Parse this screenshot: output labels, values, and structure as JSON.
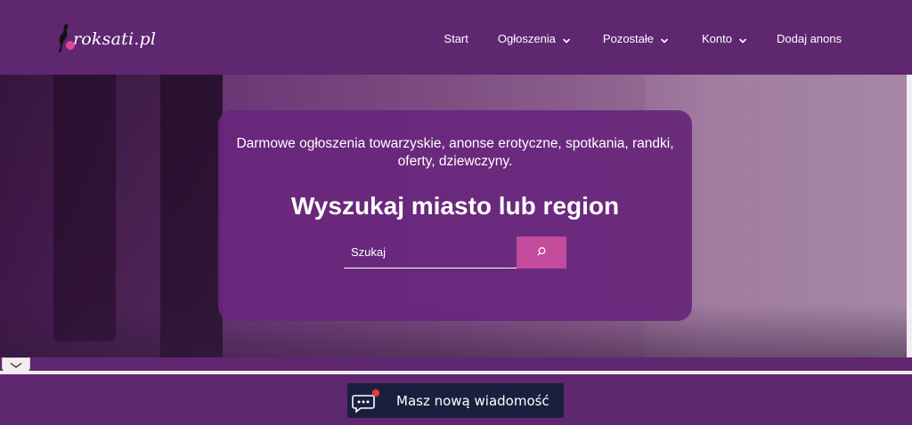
{
  "header": {
    "logo_text": "roksati.pl",
    "nav": {
      "start": "Start",
      "ogloszenia": "Ogłoszenia",
      "pozostale": "Pozostałe",
      "konto": "Konto",
      "dodaj": "Dodaj anons"
    }
  },
  "hero": {
    "description": "Darmowe ogłoszenia towarzyskie, anonse erotyczne, spotkania, randki, oferty, dziewczyny.",
    "title": "Wyszukaj miasto lub region",
    "search": {
      "placeholder": "Szukaj",
      "value": ""
    }
  },
  "notification": {
    "text": "Masz nową wiadomość"
  },
  "colors": {
    "brand_purple": "#5e2770",
    "card_purple": "#68267c",
    "accent_pink": "#c44a9c",
    "notification_bg": "#1b1f3e",
    "badge_red": "#e53935"
  }
}
